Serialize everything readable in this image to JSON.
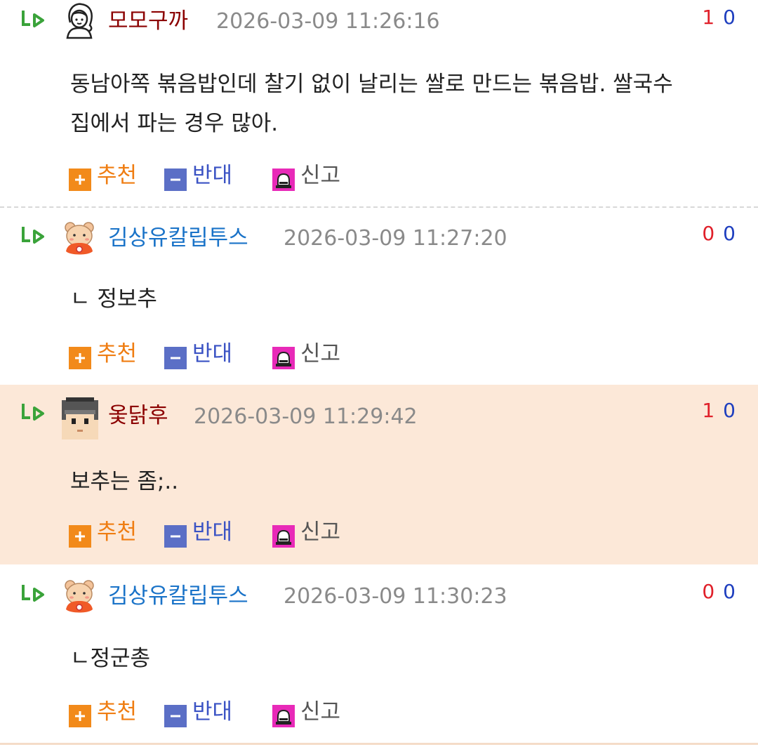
{
  "comments": [
    {
      "nickname": "모모구까",
      "date": "2026-03-09 11:26:16",
      "upvotes": "1",
      "downvotes": "0",
      "lines": [
        "동남아쪽 볶음밥인데 찰기 없이 날리는 쌀로 만드는 볶음밥. 쌀국수",
        "집에서 파는 경우 많아."
      ],
      "avatar": "woman-outline-icon",
      "highlighted": false
    },
    {
      "nickname": "김상유칼립투스",
      "date": "2026-03-09 11:27:20",
      "upvotes": "0",
      "downvotes": "0",
      "lines": [
        "ㄴ 정보추"
      ],
      "avatar": "bear-icon",
      "highlighted": false
    },
    {
      "nickname": "옻닭후",
      "date": "2026-03-09 11:29:42",
      "upvotes": "1",
      "downvotes": "0",
      "lines": [
        "보추는 좀;.."
      ],
      "avatar": "graduate-boy-icon",
      "highlighted": true
    },
    {
      "nickname": "김상유칼립투스",
      "date": "2026-03-09 11:30:23",
      "upvotes": "0",
      "downvotes": "0",
      "lines": [
        "ㄴ정군총"
      ],
      "avatar": "bear-icon",
      "highlighted": false
    }
  ],
  "actions": {
    "recommend": "추천",
    "oppose": "반대",
    "report": "신고"
  },
  "colors": {
    "highlight_bg": "#fce8d8",
    "nick_red": "#8b0000",
    "nick_blue": "#1a73c8",
    "upvote": "#e0202a",
    "downvote": "#1f3fbf",
    "recommend": "#f28a1a",
    "oppose": "#5b6fc6",
    "report": "#e82ab8"
  }
}
